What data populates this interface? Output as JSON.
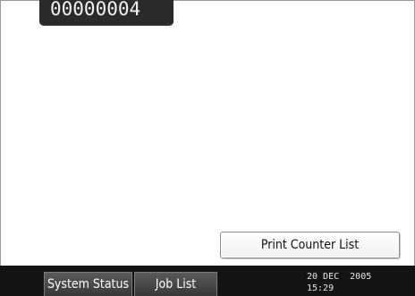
{
  "counter": {
    "value": "00000004"
  },
  "actions": {
    "print_counter_label": "Print Counter List"
  },
  "bottom_bar": {
    "system_status_label": "System Status",
    "job_list_label": "Job List",
    "date": "20 DEC  2005",
    "time": "15:29"
  },
  "colors": {
    "bottom_bar_bg": "#141414",
    "counter_bg": "#2a2a2a",
    "screen_bg": "#ffffff"
  }
}
